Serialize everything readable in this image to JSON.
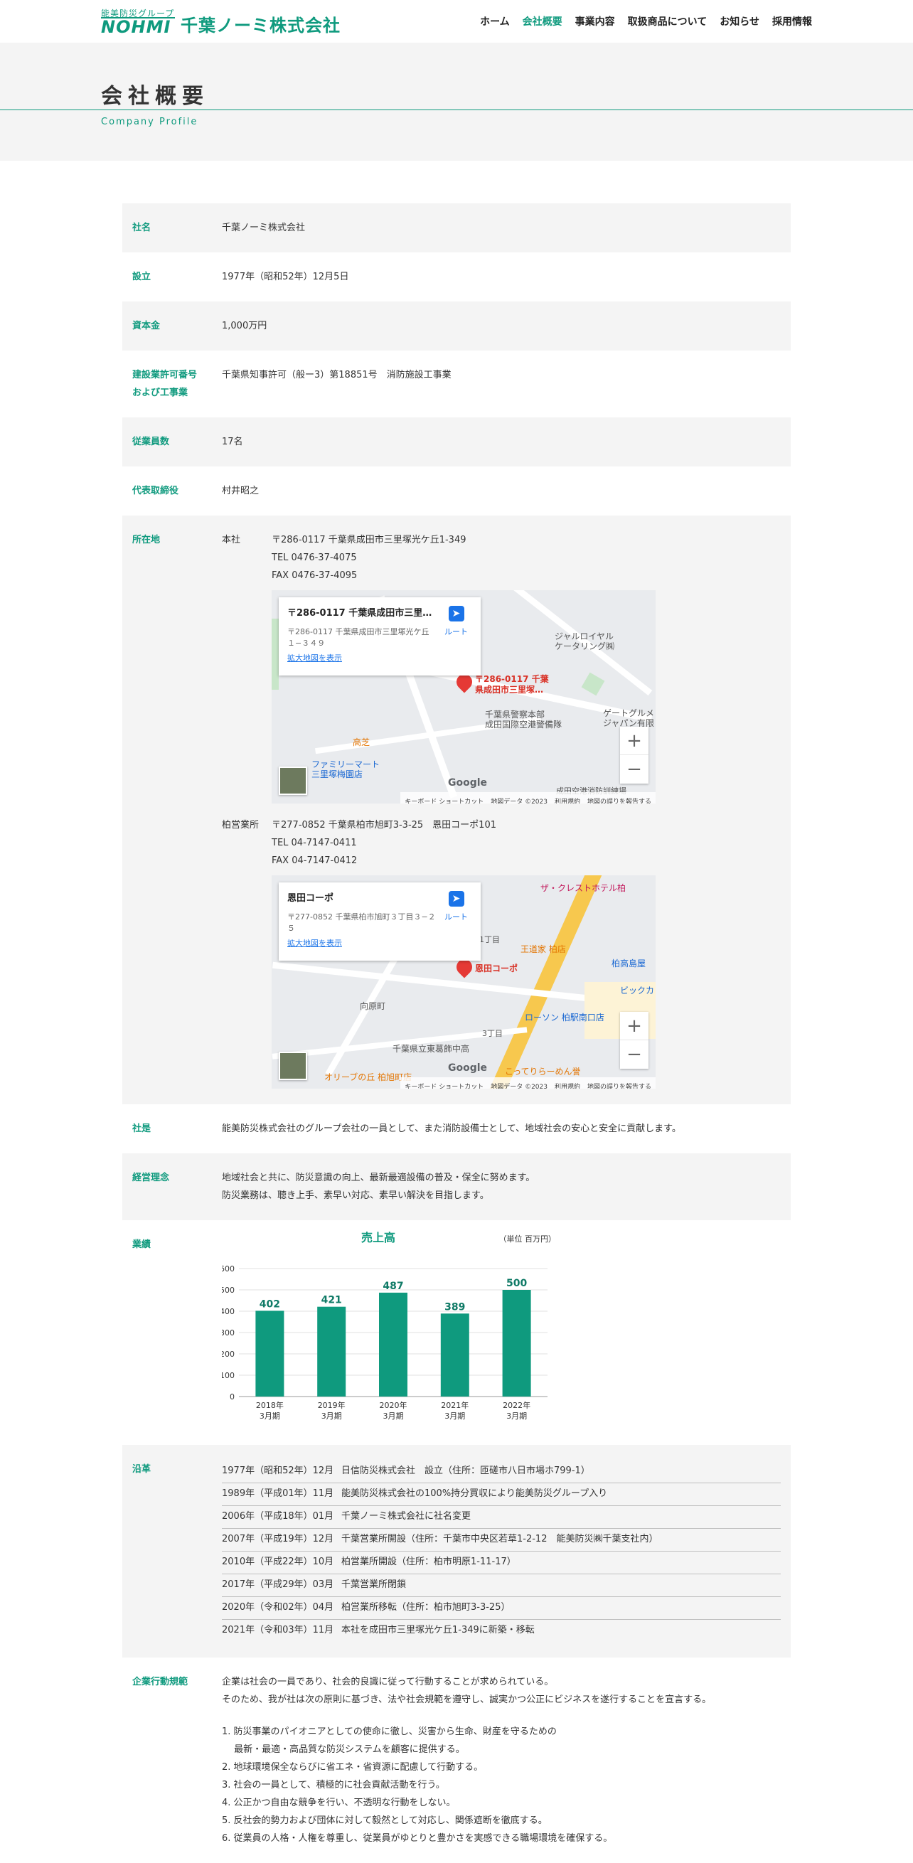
{
  "header": {
    "logo_group": "能美防災グループ",
    "logo_mark": "NOHMI",
    "company_name": "千葉ノーミ株式会社",
    "nav": [
      {
        "label": "ホーム",
        "active": false
      },
      {
        "label": "会社概要",
        "active": true
      },
      {
        "label": "事業内容",
        "active": false
      },
      {
        "label": "取扱商品について",
        "active": false
      },
      {
        "label": "お知らせ",
        "active": false
      },
      {
        "label": "採用情報",
        "active": false
      }
    ]
  },
  "hero": {
    "title": "会社概要",
    "subtitle": "Company Profile"
  },
  "profile": {
    "name": {
      "label": "社名",
      "value": "千葉ノーミ株式会社"
    },
    "founded": {
      "label": "設立",
      "value": "1977年（昭和52年）12月5日"
    },
    "capital": {
      "label": "資本金",
      "value": "1,000万円"
    },
    "license": {
      "label_1": "建設業許可番号",
      "label_2": "および工事業",
      "value": "千葉県知事許可（般ー3）第18851号　消防施設工事業"
    },
    "employees": {
      "label": "従業員数",
      "value": "17名"
    },
    "ceo": {
      "label": "代表取締役",
      "value": "村井昭之"
    },
    "location": {
      "label": "所在地",
      "head_office": {
        "label": "本社",
        "address": "〒286-0117 千葉県成田市三里塚光ケ丘1-349",
        "tel": "TEL 0476-37-4075",
        "fax": "FAX 0476-37-4095",
        "map": {
          "card_title": "〒286-0117 千葉県成田市三里塚光ケ丘1-349",
          "card_addr": "〒286-0117 千葉県成田市三里塚光ケ丘１−３４９",
          "card_link": "拡大地図を表示",
          "route": "ルート",
          "pin_label_1": "〒286-0117 千葉",
          "pin_label_2": "県成田市三里塚…",
          "pois": [
            "ジャルロイヤル",
            "ケータリング㈱",
            "千葉県警察本部",
            "成田国際空港警備隊",
            "ゲートグルメ",
            "ジャパン有限",
            "ファミリーマート",
            "三里塚梅園店",
            "高芝",
            "成田空港消防訓練場"
          ],
          "attrib": [
            "キーボード ショートカット",
            "地図データ ©2023",
            "利用規約",
            "地図の誤りを報告する"
          ]
        }
      },
      "branch": {
        "label": "柏営業所",
        "address": "〒277-0852 千葉県柏市旭町3-3-25　恩田コーポ101",
        "tel": "TEL 04-7147-0411",
        "fax": "FAX 04-7147-0412",
        "map": {
          "card_title": "恩田コーポ",
          "card_addr": "〒277-0852 千葉県柏市旭町３丁目３−２５",
          "card_link": "拡大地図を表示",
          "route": "ルート",
          "pin_label_1": "恩田コーポ",
          "pin_label_2": "",
          "pois": [
            "ザ・クレストホテル柏",
            "王道家 柏店",
            "柏高島屋",
            "ビックカ",
            "ローソン 柏駅南口店",
            "向原町",
            "千葉県立東葛飾中高",
            "オリーブの丘 柏旭町店",
            "こってりらーめん誉",
            "1丁目",
            "3丁目"
          ],
          "attrib": [
            "キーボード ショートカット",
            "地図データ ©2023",
            "利用規約",
            "地図の誤りを報告する"
          ]
        }
      }
    },
    "motto": {
      "label": "社是",
      "value": "能美防災株式会社のグループ会社の一員として、また消防設備士として、地域社会の安心と安全に貢献します。"
    },
    "philosophy": {
      "label": "経営理念",
      "line_1": "地域社会と共に、防災意識の向上、最新最適設備の普及・保全に努めます。",
      "line_2": "防災業務は、聴き上手、素早い対応、素早い解決を目指します。"
    },
    "performance": {
      "label": "業績"
    },
    "history": {
      "label": "沿革",
      "items": [
        {
          "date": "1977年（昭和52年）12月",
          "text": "日信防災株式会社　設立（住所：匝磋市八日市場ホ799-1）"
        },
        {
          "date": "1989年（平成01年）11月",
          "text": "能美防災株式会社の100%持分買収により能美防災グループ入り"
        },
        {
          "date": "2006年（平成18年）01月",
          "text": "千葉ノーミ株式会社に社名変更"
        },
        {
          "date": "2007年（平成19年）12月",
          "text": "千葉営業所開設（住所：千葉市中央区若草1-2-12　能美防災㈱千葉支社内）"
        },
        {
          "date": "2010年（平成22年）10月",
          "text": "柏営業所開設（住所：柏市明原1-11-17）"
        },
        {
          "date": "2017年（平成29年）03月",
          "text": "千葉営業所閉鎖"
        },
        {
          "date": "2020年（令和02年）04月",
          "text": "柏営業所移転（住所：柏市旭町3-3-25）"
        },
        {
          "date": "2021年（令和03年）11月",
          "text": "本社を成田市三里塚光ケ丘1-349に新築・移転"
        }
      ]
    },
    "code": {
      "label": "企業行動規範",
      "intro_1": "企業は社会の一員であり、社会的良識に従って行動することが求められている。",
      "intro_2": "そのため、我が社は次の原則に基づき、法や社会規範を遵守し、誠実かつ公正にビジネスを遂行することを宣言する。",
      "items": [
        "1. 防災事業のパイオニアとしての使命に徹し、災害から生命、財産を守るための",
        "　 最新・最適・高品質な防災システムを顧客に提供する。",
        "2. 地球環境保全ならびに省エネ・省資源に配慮して行動する。",
        "3. 社会の一員として、積極的に社会貢献活動を行う。",
        "4. 公正かつ自由な競争を行い、不透明な行動をしない。",
        "5. 反社会的勢力および団体に対して毅然として対応し、関係遮断を徹底する。",
        "6. 従業員の人格・人権を尊重し、従業員がゆとりと豊かさを実感できる職場環境を確保する。"
      ]
    }
  },
  "colors": {
    "accent": "#0f9a7e",
    "bar": "#0f9a7e",
    "row_gray": "#f4f4f4"
  },
  "chart_data": {
    "type": "bar",
    "title": "売上高",
    "unit": "（単位 百万円）",
    "categories": [
      "2018年\n3月期",
      "2019年\n3月期",
      "2020年\n3月期",
      "2021年\n3月期",
      "2022年\n3月期"
    ],
    "values": [
      402,
      421,
      487,
      389,
      500
    ],
    "yticks": [
      0,
      100,
      200,
      300,
      400,
      500,
      600
    ],
    "ylim": [
      0,
      600
    ],
    "grid": true,
    "xlabel": "",
    "ylabel": ""
  }
}
